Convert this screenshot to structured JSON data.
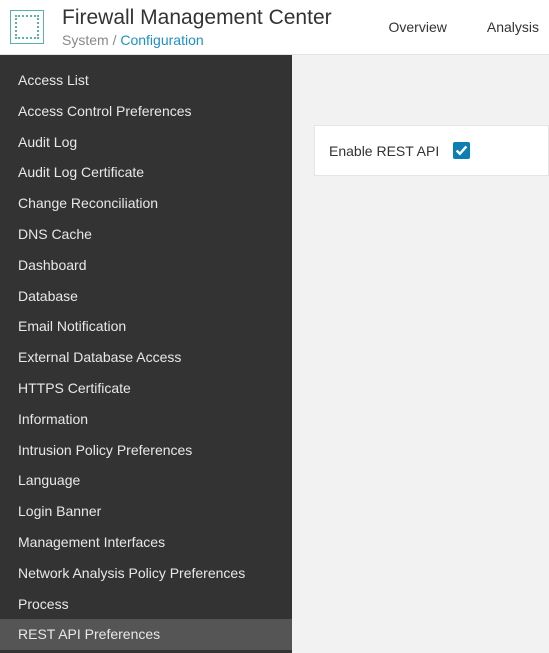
{
  "header": {
    "title": "Firewall Management Center",
    "breadcrumb_root": "System",
    "breadcrumb_sep": " / ",
    "breadcrumb_current": "Configuration"
  },
  "nav": {
    "tabs": [
      "Overview",
      "Analysis"
    ]
  },
  "sidebar": {
    "items": [
      {
        "label": "Access List",
        "selected": false
      },
      {
        "label": "Access Control Preferences",
        "selected": false
      },
      {
        "label": "Audit Log",
        "selected": false
      },
      {
        "label": "Audit Log Certificate",
        "selected": false
      },
      {
        "label": "Change Reconciliation",
        "selected": false
      },
      {
        "label": "DNS Cache",
        "selected": false
      },
      {
        "label": "Dashboard",
        "selected": false
      },
      {
        "label": "Database",
        "selected": false
      },
      {
        "label": "Email Notification",
        "selected": false
      },
      {
        "label": "External Database Access",
        "selected": false
      },
      {
        "label": "HTTPS Certificate",
        "selected": false
      },
      {
        "label": "Information",
        "selected": false
      },
      {
        "label": "Intrusion Policy Preferences",
        "selected": false
      },
      {
        "label": "Language",
        "selected": false
      },
      {
        "label": "Login Banner",
        "selected": false
      },
      {
        "label": "Management Interfaces",
        "selected": false
      },
      {
        "label": "Network Analysis Policy Preferences",
        "selected": false
      },
      {
        "label": "Process",
        "selected": false
      },
      {
        "label": "REST API Preferences",
        "selected": true
      }
    ]
  },
  "main": {
    "enable_rest_api_label": "Enable REST API",
    "enable_rest_api_checked": true
  }
}
